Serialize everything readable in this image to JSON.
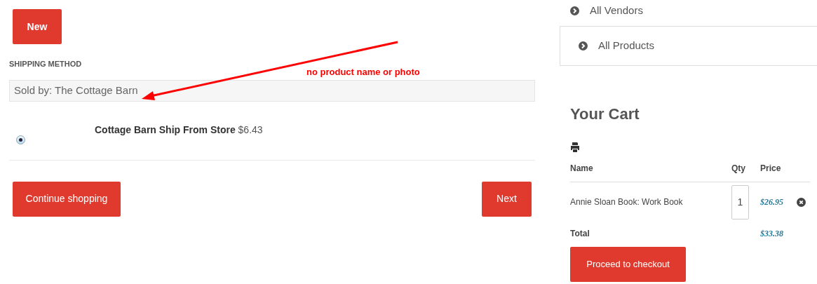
{
  "buttons": {
    "new": "New",
    "continue": "Continue shopping",
    "next": "Next"
  },
  "shipping": {
    "heading": "SHIPPING METHOD",
    "sold_by": "Sold by: The Cottage Barn",
    "options": [
      {
        "name": "Cottage Barn Ship From Store",
        "price": "$6.43",
        "selected": true
      }
    ]
  },
  "annotation": {
    "text": "no product name or photo"
  },
  "sidebar": {
    "links": [
      "All Vendors",
      "All Products"
    ]
  },
  "cart": {
    "title": "Your Cart",
    "columns": [
      "Name",
      "Qty",
      "Price"
    ],
    "rows": [
      {
        "name": "Annie Sloan Book: Work Book",
        "qty": "1",
        "price": "$26.95"
      }
    ],
    "total_label": "Total",
    "total": "$33.38",
    "checkout": "Proceed to checkout"
  }
}
